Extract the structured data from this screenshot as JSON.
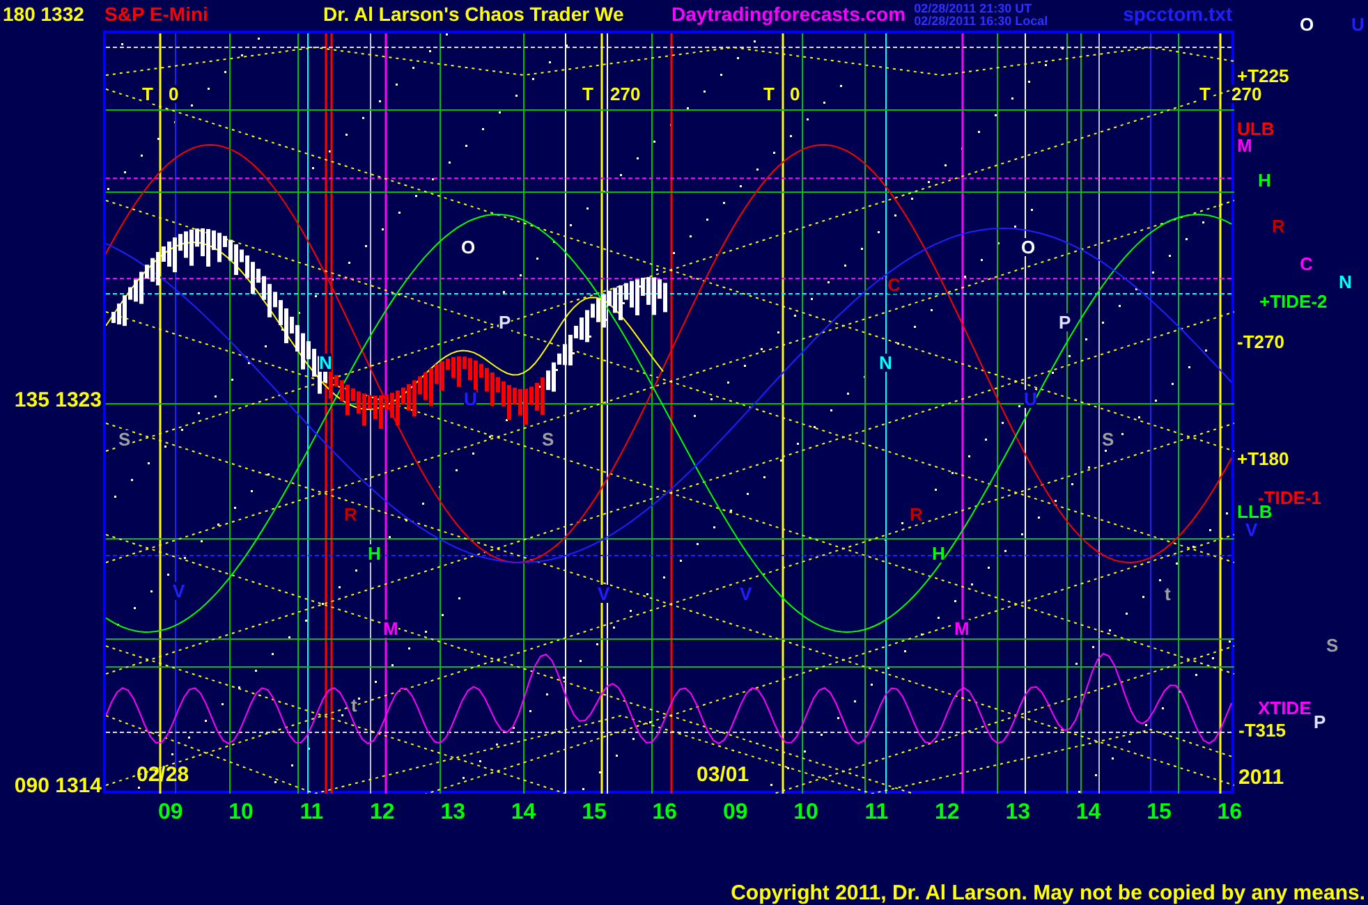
{
  "header": {
    "scale_label": "180 1332",
    "symbol": "S&P E-Mini",
    "title": "Dr. Al Larson's Chaos Trader We",
    "site": "Daytradingforecasts.com",
    "timestamps": [
      "02/28/2011 21:30 UT",
      "02/28/2011 16:30 Local"
    ],
    "file": "spcctom.txt"
  },
  "axis_labels": [
    "135 1323",
    "090 1314"
  ],
  "markers": [
    {
      "text": "O",
      "color": "#ffffff"
    },
    {
      "text": "U",
      "color": "#2020ff"
    },
    {
      "text": "T",
      "color": "#ffff00"
    },
    {
      "text": "0",
      "color": "#ffff00"
    },
    {
      "text": "T",
      "color": "#ffff00"
    },
    {
      "text": "270",
      "color": "#ffff00"
    },
    {
      "text": "T",
      "color": "#ffff00"
    },
    {
      "text": "0",
      "color": "#ffff00"
    },
    {
      "text": "T",
      "color": "#ffff00"
    },
    {
      "text": "+T225",
      "color": "#ffff00"
    },
    {
      "text": "270",
      "color": "#ffff00"
    },
    {
      "text": "ULB",
      "color": "#ff0000"
    },
    {
      "text": "M",
      "color": "#ff00ff"
    },
    {
      "text": "H",
      "color": "#00ff00"
    },
    {
      "text": "R",
      "color": "#c00000"
    },
    {
      "text": "C",
      "color": "#ff00ff"
    },
    {
      "text": "N",
      "color": "#00ffff"
    },
    {
      "text": "+TIDE-2",
      "color": "#00ff00"
    },
    {
      "text": "-T270",
      "color": "#ffff00"
    },
    {
      "text": "+T180",
      "color": "#ffff00"
    },
    {
      "text": "-TIDE-1",
      "color": "#ff0000"
    },
    {
      "text": "LLB",
      "color": "#00ff00"
    },
    {
      "text": "V",
      "color": "#2020ff"
    },
    {
      "text": "S",
      "color": "#a0a0a0"
    },
    {
      "text": "XTIDE",
      "color": "#ff00ff"
    },
    {
      "text": "-T315",
      "color": "#ffff00"
    },
    {
      "text": "P",
      "color": "#e0e0ff"
    },
    {
      "text": "O",
      "color": "#ffffff"
    },
    {
      "text": "O",
      "color": "#ffffff"
    },
    {
      "text": "P",
      "color": "#e0e0ff"
    },
    {
      "text": "P",
      "color": "#e0e0ff"
    },
    {
      "text": "C",
      "color": "#c00000"
    },
    {
      "text": "N",
      "color": "#00ffff"
    },
    {
      "text": "N",
      "color": "#00ffff"
    },
    {
      "text": "S",
      "color": "#a0a0a0"
    },
    {
      "text": "S",
      "color": "#a0a0a0"
    },
    {
      "text": "S",
      "color": "#a0a0a0"
    },
    {
      "text": "U",
      "color": "#2020ff"
    },
    {
      "text": "U",
      "color": "#2020ff"
    },
    {
      "text": "R",
      "color": "#c00000"
    },
    {
      "text": "R",
      "color": "#c00000"
    },
    {
      "text": "H",
      "color": "#00ff00"
    },
    {
      "text": "H",
      "color": "#00ff00"
    },
    {
      "text": "M",
      "color": "#ff00ff"
    },
    {
      "text": "M",
      "color": "#ff00ff"
    },
    {
      "text": "V",
      "color": "#2020ff"
    },
    {
      "text": "V",
      "color": "#2020ff"
    },
    {
      "text": "V",
      "color": "#2020ff"
    },
    {
      "text": "t",
      "color": "#a0a0a0"
    },
    {
      "text": "t",
      "color": "#a0a0a0"
    }
  ],
  "date_labels": [
    "02/28",
    "03/01",
    "2011"
  ],
  "hours": [
    "09",
    "10",
    "11",
    "12",
    "13",
    "14",
    "15",
    "16",
    "09",
    "10",
    "11",
    "12",
    "13",
    "14",
    "15",
    "16"
  ],
  "copyright": "Copyright 2011, Dr. Al Larson. May not be copied by any means."
}
